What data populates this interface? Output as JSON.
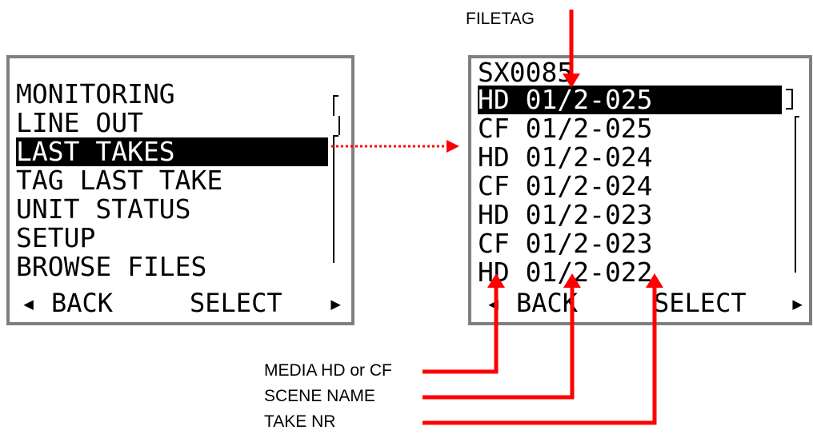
{
  "left_menu": {
    "items": [
      "MONITORING",
      "LINE OUT",
      "LAST TAKES",
      "TAG LAST TAKE",
      "UNIT STATUS",
      "SETUP",
      "BROWSE FILES"
    ],
    "selected_index": 2,
    "back_label": "BACK",
    "select_label": "SELECT"
  },
  "right_list": {
    "header": "SX0085",
    "items": [
      "HD 01/2-025",
      "CF 01/2-025",
      "HD 01/2-024",
      "CF 01/2-024",
      "HD 01/2-023",
      "CF 01/2-023",
      "HD 01/2-022"
    ],
    "selected_index": 0,
    "back_label": "BACK",
    "select_label": "SELECT"
  },
  "annotations": {
    "filetag": "FILETAG",
    "media": "MEDIA HD or CF",
    "scene": "SCENE NAME",
    "take": "TAKE NR"
  },
  "colors": {
    "arrow": "#ff0000",
    "frame": "#7f7f7f"
  }
}
